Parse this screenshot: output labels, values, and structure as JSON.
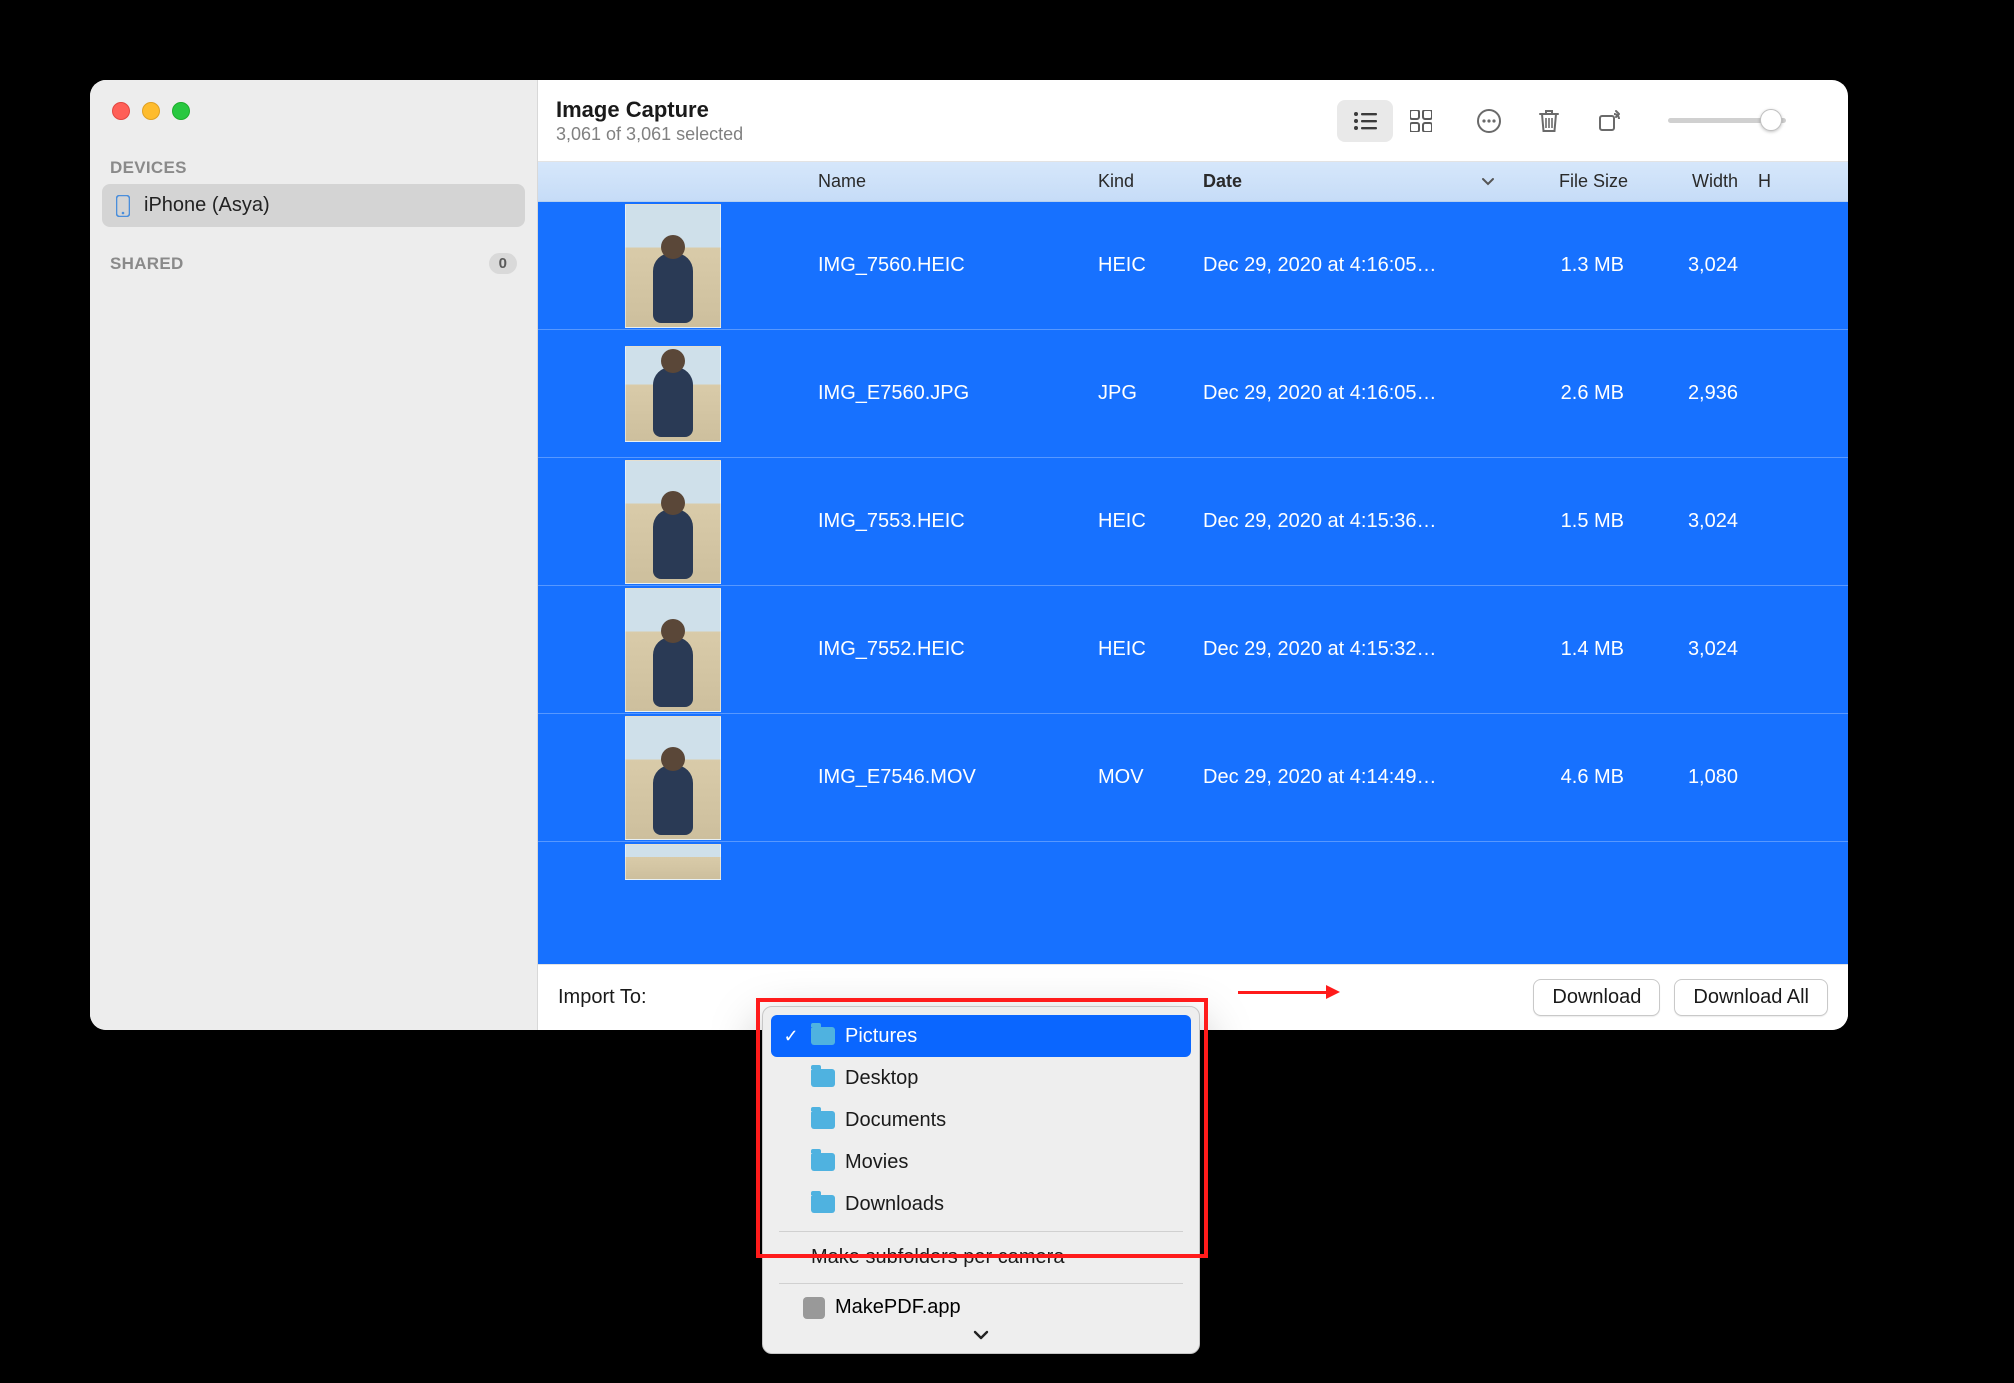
{
  "app": {
    "title": "Image Capture",
    "subtitle": "3,061 of 3,061 selected"
  },
  "sidebar": {
    "devices_label": "DEVICES",
    "shared_label": "SHARED",
    "shared_count": "0",
    "devices": [
      {
        "name": "iPhone (Asya)"
      }
    ]
  },
  "columns": {
    "name": "Name",
    "kind": "Kind",
    "date": "Date",
    "file_size": "File Size",
    "width": "Width",
    "h": "H"
  },
  "rows": [
    {
      "name": "IMG_7560.HEIC",
      "kind": "HEIC",
      "date": "Dec 29, 2020 at 4:16:05…",
      "size": "1.3 MB",
      "width": "3,024"
    },
    {
      "name": "IMG_E7560.JPG",
      "kind": "JPG",
      "date": "Dec 29, 2020 at 4:16:05…",
      "size": "2.6 MB",
      "width": "2,936"
    },
    {
      "name": "IMG_7553.HEIC",
      "kind": "HEIC",
      "date": "Dec 29, 2020 at 4:15:36…",
      "size": "1.5 MB",
      "width": "3,024"
    },
    {
      "name": "IMG_7552.HEIC",
      "kind": "HEIC",
      "date": "Dec 29, 2020 at 4:15:32…",
      "size": "1.4 MB",
      "width": "3,024"
    },
    {
      "name": "IMG_E7546.MOV",
      "kind": "MOV",
      "date": "Dec 29, 2020 at 4:14:49…",
      "size": "4.6 MB",
      "width": "1,080"
    }
  ],
  "footer": {
    "import_to": "Import To:",
    "download": "Download",
    "download_all": "Download All"
  },
  "popup": {
    "items": [
      {
        "label": "Pictures",
        "selected": true
      },
      {
        "label": "Desktop",
        "selected": false
      },
      {
        "label": "Documents",
        "selected": false
      },
      {
        "label": "Movies",
        "selected": false
      },
      {
        "label": "Downloads",
        "selected": false
      }
    ],
    "subfolders": "Make subfolders per camera",
    "app": "MakePDF.app"
  }
}
